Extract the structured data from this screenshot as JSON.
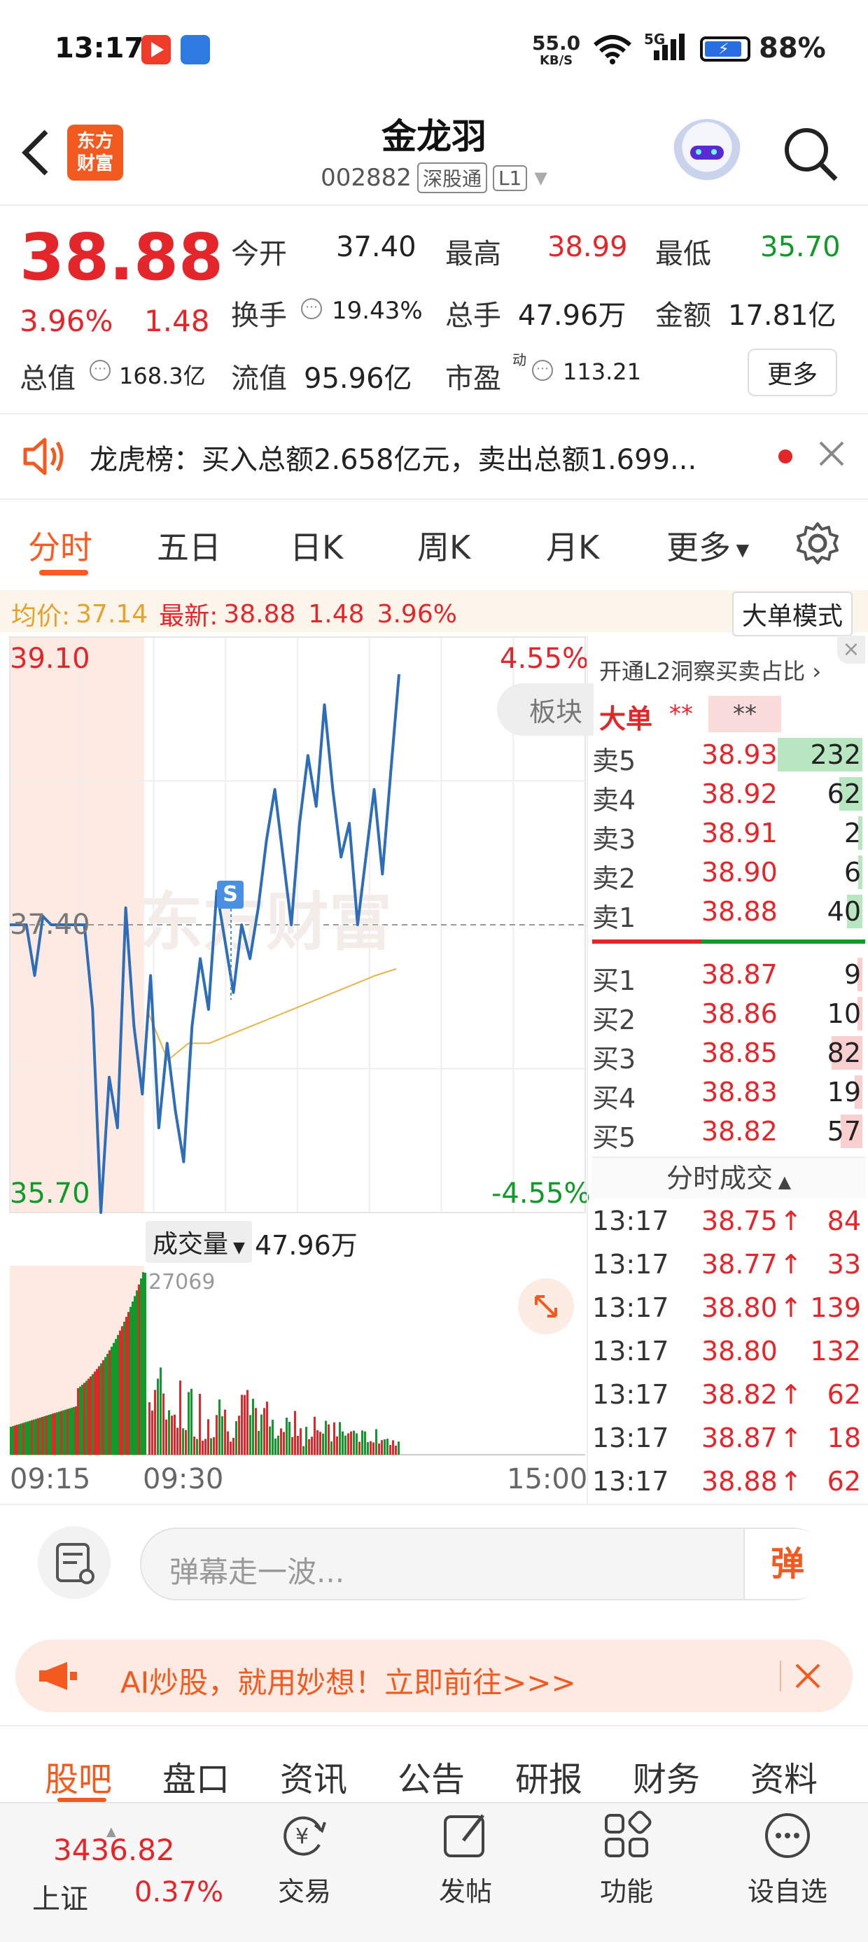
{
  "status_bar": {
    "time": "13:17",
    "net_speed": "55.0",
    "net_unit": "KB/S",
    "signal": "5G",
    "battery": "88%"
  },
  "header": {
    "title": "金龙羽",
    "code": "002882",
    "tag1": "深股通",
    "tag2": "L1",
    "logo_line1": "东方",
    "logo_line2": "财富"
  },
  "quote": {
    "price": "38.88",
    "change_pct": "3.96%",
    "change": "1.48",
    "open_label": "今开",
    "open": "37.40",
    "high_label": "最高",
    "high": "38.99",
    "low_label": "最低",
    "low": "35.70",
    "turnover_label": "换手",
    "turnover": "19.43%",
    "volume_label": "总手",
    "volume": "47.96万",
    "amount_label": "金额",
    "amount": "17.81亿",
    "mcap_label": "总值",
    "mcap": "168.3亿",
    "float_label": "流值",
    "float": "95.96亿",
    "pe_label": "市盈",
    "pe_sup": "动",
    "pe": "113.21",
    "more": "更多"
  },
  "notice": {
    "text": "龙虎榜：买入总额2.658亿元，卖出总额1.699..."
  },
  "tabs": [
    "分时",
    "五日",
    "日K",
    "周K",
    "月K",
    "更多"
  ],
  "info_line": {
    "avg_label": "均价:",
    "avg": "37.14",
    "latest_label": "最新:",
    "latest": "38.88",
    "change": "1.48",
    "pct": "3.96%",
    "big_order_btn": "大单模式"
  },
  "chart_labels": {
    "top_price": "39.10",
    "top_pct": "4.55%",
    "mid_price": "37.40",
    "bottom_price": "35.70",
    "bottom_pct": "-4.55%",
    "sector_btn": "板块",
    "marker": "S",
    "watermark": "东方财富",
    "volume_label": "成交量",
    "volume_total": "47.96万",
    "volume_max": "27069",
    "time_start": "09:15",
    "time_open": "09:30",
    "time_end": "15:00"
  },
  "chart_data": [
    {
      "type": "line",
      "title": "分时",
      "x_range": [
        "09:15",
        "15:00"
      ],
      "ylim": [
        35.7,
        39.1
      ],
      "reference": 37.4,
      "series": [
        {
          "name": "最新",
          "values": [
            37.4,
            37.4,
            37.4,
            37.1,
            37.45,
            37.4,
            37.4,
            37.4,
            37.4,
            37.4,
            36.9,
            35.7,
            36.5,
            36.2,
            37.5,
            36.8,
            36.4,
            37.1,
            36.2,
            36.7,
            36.3,
            36.0,
            36.8,
            37.2,
            36.9,
            37.6,
            37.3,
            37.0,
            37.4,
            37.2,
            37.5,
            37.9,
            38.2,
            37.8,
            37.4,
            38.0,
            38.4,
            38.1,
            38.7,
            38.2,
            37.8,
            38.0,
            37.4,
            37.8,
            38.2,
            37.7,
            38.3,
            38.88
          ]
        },
        {
          "name": "均价",
          "values": [
            36.9,
            36.6,
            36.7,
            36.7,
            36.75,
            36.8,
            36.85,
            36.9,
            36.95,
            37.0,
            37.05,
            37.1,
            37.14
          ]
        }
      ]
    },
    {
      "type": "bar",
      "title": "成交量",
      "total": "47.96万",
      "ymax": 27069
    }
  ],
  "order_book": {
    "link": "开通L2洞察买卖占比",
    "big_label": "大单",
    "big_v1": "**",
    "big_v2": "**",
    "asks": [
      {
        "label": "卖5",
        "price": "38.93",
        "vol": "232",
        "ratio": 0.55
      },
      {
        "label": "卖4",
        "price": "38.92",
        "vol": "62",
        "ratio": 0.15
      },
      {
        "label": "卖3",
        "price": "38.91",
        "vol": "2",
        "ratio": 0.01
      },
      {
        "label": "卖2",
        "price": "38.90",
        "vol": "6",
        "ratio": 0.02
      },
      {
        "label": "卖1",
        "price": "38.88",
        "vol": "40",
        "ratio": 0.1
      }
    ],
    "bids": [
      {
        "label": "买1",
        "price": "38.87",
        "vol": "9",
        "ratio": 0.03
      },
      {
        "label": "买2",
        "price": "38.86",
        "vol": "10",
        "ratio": 0.03
      },
      {
        "label": "买3",
        "price": "38.85",
        "vol": "82",
        "ratio": 0.2
      },
      {
        "label": "买4",
        "price": "38.83",
        "vol": "19",
        "ratio": 0.05
      },
      {
        "label": "买5",
        "price": "38.82",
        "vol": "57",
        "ratio": 0.14
      }
    ],
    "trades_title": "分时成交",
    "trades": [
      {
        "time": "13:17",
        "price": "38.75",
        "arrow": "↑",
        "vol": "84"
      },
      {
        "time": "13:17",
        "price": "38.77",
        "arrow": "↑",
        "vol": "33"
      },
      {
        "time": "13:17",
        "price": "38.80",
        "arrow": "↑",
        "vol": "139"
      },
      {
        "time": "13:17",
        "price": "38.80",
        "arrow": "",
        "vol": "132"
      },
      {
        "time": "13:17",
        "price": "38.82",
        "arrow": "↑",
        "vol": "62"
      },
      {
        "time": "13:17",
        "price": "38.87",
        "arrow": "↑",
        "vol": "18"
      },
      {
        "time": "13:17",
        "price": "38.88",
        "arrow": "↑",
        "vol": "62"
      }
    ]
  },
  "comment": {
    "placeholder": "弹幕走一波...",
    "danmu": "弹"
  },
  "ad": {
    "text": "AI炒股，就用妙想！立即前往>>>"
  },
  "bottom_tabs": [
    "股吧",
    "盘口",
    "资讯",
    "公告",
    "研报",
    "财务",
    "资料"
  ],
  "nav": {
    "index_value": "3436.82",
    "index_name": "上证",
    "index_pct": "0.37%",
    "items": [
      "交易",
      "发帖",
      "功能",
      "设自选"
    ]
  },
  "colors": {
    "up": "#e4262b",
    "down": "#0f9a2a",
    "line": "#2e6db8",
    "avg": "#e6b54a",
    "accent": "#ff5a1f"
  }
}
